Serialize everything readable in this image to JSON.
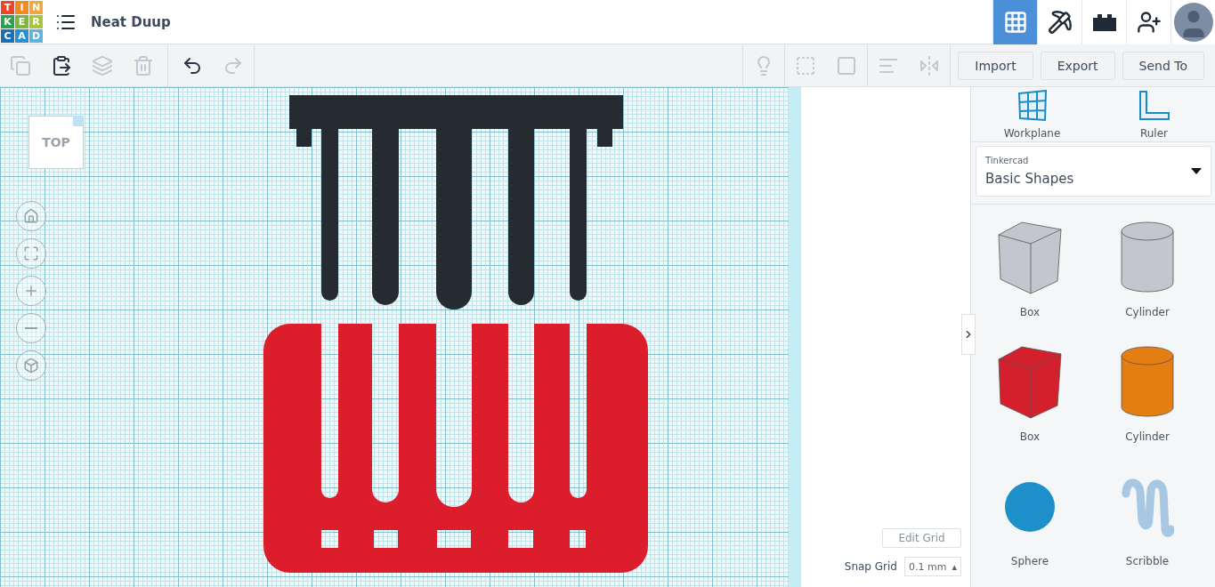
{
  "header": {
    "logo_letters": [
      "T",
      "I",
      "N",
      "K",
      "E",
      "R",
      "C",
      "A",
      "D"
    ],
    "title": "Neat Duup",
    "nav": [
      {
        "kind": "grid",
        "selected": true
      },
      {
        "kind": "pickaxe",
        "selected": false
      },
      {
        "kind": "bricks",
        "selected": false
      },
      {
        "kind": "add-user",
        "selected": false
      },
      {
        "kind": "avatar",
        "selected": false
      }
    ]
  },
  "toolbar": {
    "tools": [
      {
        "kind": "copy",
        "disabled": true
      },
      {
        "kind": "paste",
        "disabled": false
      },
      {
        "kind": "duplicate",
        "disabled": true
      },
      {
        "kind": "delete",
        "disabled": true
      },
      {
        "kind": "undo",
        "disabled": false
      },
      {
        "kind": "redo",
        "disabled": true
      }
    ],
    "shape_tools": [
      {
        "kind": "light",
        "disabled": true
      },
      {
        "kind": "group",
        "disabled": true
      },
      {
        "kind": "ungroup",
        "disabled": true
      },
      {
        "kind": "align",
        "disabled": true
      },
      {
        "kind": "mirror",
        "disabled": true
      }
    ],
    "buttons": [
      "Import",
      "Export",
      "Send To"
    ]
  },
  "canvas": {
    "view_cube": "TOP",
    "nav_buttons": [
      {
        "kind": "home"
      },
      {
        "kind": "fit"
      },
      {
        "kind": "zoom-in"
      },
      {
        "kind": "zoom-out"
      },
      {
        "kind": "perspective"
      }
    ],
    "edit_grid": "Edit Grid",
    "snap_grid_label": "Snap Grid",
    "snap_grid_value": "0.1 mm",
    "snap_caret": "▴"
  },
  "panel": {
    "tools": [
      {
        "kind": "workplane",
        "label": "Workplane"
      },
      {
        "kind": "ruler",
        "label": "Ruler"
      }
    ],
    "library": {
      "caption": "Tinkercad",
      "value": "Basic Shapes"
    },
    "shapes": [
      {
        "kind": "box",
        "label": "Box",
        "color": "#c3c7cd"
      },
      {
        "kind": "cylinder",
        "label": "Cylinder",
        "color": "#c3c7cd"
      },
      {
        "kind": "box",
        "label": "Box",
        "color": "#d3202c"
      },
      {
        "kind": "cylinder",
        "label": "Cylinder",
        "color": "#e47e12"
      },
      {
        "kind": "sphere",
        "label": "Sphere",
        "color": "#1d8fca"
      },
      {
        "kind": "scribble",
        "label": "Scribble",
        "color": "#a8c7e2"
      }
    ]
  }
}
